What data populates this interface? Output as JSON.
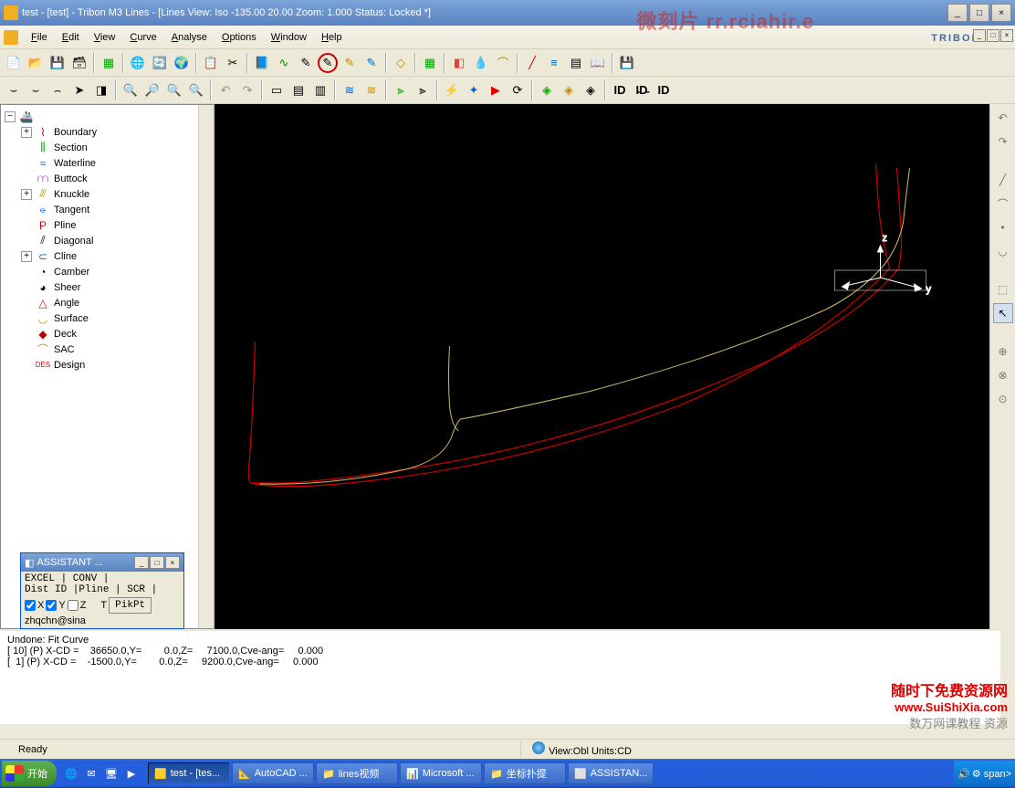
{
  "title": "test - [test] - Tribon M3 Lines - [Lines View: Iso -135.00 20.00   Zoom: 1.000   Status: Locked *]",
  "menus": [
    "File",
    "Edit",
    "View",
    "Curve",
    "Analyse",
    "Options",
    "Window",
    "Help"
  ],
  "logo": "TRIBON",
  "tree": {
    "items": [
      {
        "label": "Boundary",
        "exp": "+"
      },
      {
        "label": "Section"
      },
      {
        "label": "Waterline"
      },
      {
        "label": "Buttock"
      },
      {
        "label": "Knuckle",
        "exp": "+"
      },
      {
        "label": "Tangent"
      },
      {
        "label": "Pline"
      },
      {
        "label": "Diagonal"
      },
      {
        "label": "Cline",
        "exp": "+"
      },
      {
        "label": "Camber"
      },
      {
        "label": "Sheer"
      },
      {
        "label": "Angle"
      },
      {
        "label": "Surface"
      },
      {
        "label": "Deck"
      },
      {
        "label": "SAC"
      },
      {
        "label": "Design"
      }
    ]
  },
  "assistant": {
    "title": "ASSISTANT ...",
    "tab1": " EXCEL | CONV |",
    "tab2": " Dist  ID |Pline | SCR |",
    "x": "X",
    "y": "Y",
    "z": "Z",
    "t": "T",
    "email": "zhqchn@sina",
    "pikpt": "PikPt"
  },
  "console": {
    "l1": "Undone: Fit Curve",
    "l2": "[ 10] (P) X-CD =    36650.0,Y=        0.0,Z=     7100.0,Cve-ang=     0.000",
    "l3": "[  1] (P) X-CD =    -1500.0,Y=        0.0,Z=     9200.0,Cve-ang=     0.000"
  },
  "status": {
    "ready": "Ready",
    "view": "View:Obl  Units:CD"
  },
  "taskbar": {
    "start": "开始",
    "tasks": [
      {
        "label": "test - [tes..."
      },
      {
        "label": "AutoCAD ..."
      },
      {
        "label": "lines视频"
      },
      {
        "label": "Microsoft ..."
      },
      {
        "label": "坐标扑提"
      },
      {
        "label": "ASSISTAN..."
      }
    ]
  },
  "watermark": {
    "l1": "随时下免费资源网",
    "l2": "www.SuiShiXia.com",
    "l3": "数万网课教程 资源"
  },
  "topwm": "微刻片 rr.rciahir.e"
}
